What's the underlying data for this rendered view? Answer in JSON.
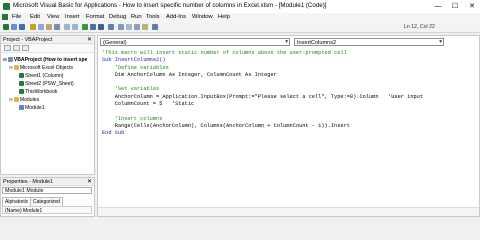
{
  "window": {
    "title": "Microsoft Visual Basic for Applications - How to insert specific number of columns in Excel.xlsm - [Module1 (Code)]",
    "controls": [
      "—",
      "☐",
      "✕"
    ]
  },
  "menu": [
    "File",
    "Edit",
    "View",
    "Insert",
    "Format",
    "Debug",
    "Run",
    "Tools",
    "Add-Ins",
    "Window",
    "Help"
  ],
  "toolbar": {
    "status": "Ln 12, Col 22"
  },
  "project": {
    "title": "Project - VBAProject",
    "close": "✕",
    "tree": [
      {
        "label": "VBAProject (How to insert spe",
        "bold": true,
        "expander": "⊟"
      },
      {
        "label": "Microsoft Excel Objects",
        "expander": "⊟"
      },
      {
        "label": "Sheet1 (Column)"
      },
      {
        "label": "Sheet2 (PSW_Sheet)"
      },
      {
        "label": "ThisWorkbook"
      },
      {
        "label": "Modules",
        "expander": "⊟"
      },
      {
        "label": "Module1"
      }
    ]
  },
  "properties": {
    "title": "Properties - Module1",
    "close": "✕",
    "combo": "Module1  Module",
    "tabs": [
      "Alphabetic",
      "Categorized"
    ],
    "row": "(Name)  Module1"
  },
  "code_window": {
    "left_combo": "(General)",
    "right_combo": "InsertColumns2",
    "lines": [
      {
        "text": "'This macro will insert static number of columns above the user-prompted cell",
        "kind": "comment"
      },
      {
        "text": "Sub InsertColumns2()",
        "kind": "keyword"
      },
      {
        "text": "    'Define variables",
        "kind": "comment"
      },
      {
        "text": "    Dim AnchorColumn As Integer, ColumnCount As Integer",
        "kind": "code"
      },
      {
        "text": "",
        "kind": "code"
      },
      {
        "text": "    'Set variables",
        "kind": "comment"
      },
      {
        "text": "    AnchorColumn = Application.InputBox(Prompt:=\"Please select a cell\", Type:=8).Column   'User input",
        "kind": "code"
      },
      {
        "text": "    ColumnCount = 5   'Static",
        "kind": "code"
      },
      {
        "text": "",
        "kind": "code"
      },
      {
        "text": "    'Insert columns",
        "kind": "comment"
      },
      {
        "text": "    Range(Cells(AnchorColumn), Columns(AnchorColumn + ColumnCount - 1)).Insert",
        "kind": "code"
      },
      {
        "text": "End Sub",
        "kind": "keyword"
      }
    ]
  },
  "colors": {
    "excel_green": "#1e7a3c",
    "comment": "#1a8a1a",
    "keyword": "#1a1aa6"
  }
}
